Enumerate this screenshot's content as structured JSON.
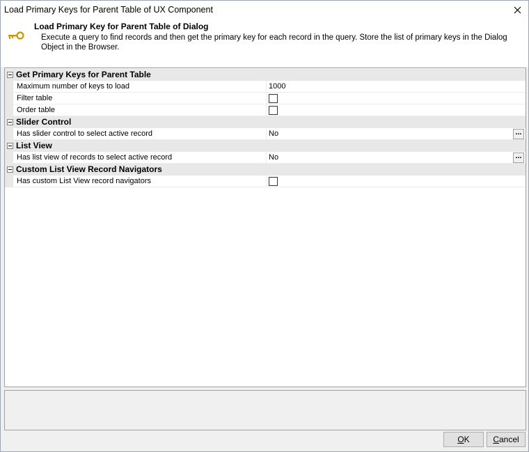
{
  "window": {
    "title": "Load Primary Keys for Parent Table of UX Component"
  },
  "header": {
    "title": "Load Primary Key for Parent Table of Dialog",
    "description": "Execute a query to find records and then get the primary key for each record in the query. Store the list of primary keys in the Dialog Object in the Browser."
  },
  "sections": [
    {
      "label": "Get Primary Keys for Parent Table",
      "properties": [
        {
          "name": "Maximum number of keys to load",
          "value": "1000"
        },
        {
          "name": "Filter table",
          "checked": false
        },
        {
          "name": "Order table",
          "checked": false
        }
      ]
    },
    {
      "label": "Slider Control",
      "properties": [
        {
          "name": "Has slider control to select active record",
          "value": "No",
          "button": "..."
        }
      ]
    },
    {
      "label": "List View",
      "properties": [
        {
          "name": "Has list view of records to select active record",
          "value": "No",
          "button": "..."
        }
      ]
    },
    {
      "label": "Custom List View Record Navigators",
      "properties": [
        {
          "name": "Has custom List View record navigators",
          "checked": false
        }
      ]
    }
  ],
  "buttons": {
    "ok_accel": "O",
    "ok_rest": "K",
    "cancel_accel": "C",
    "cancel_rest": "ancel"
  },
  "icons": {
    "header": "key-icon",
    "close": "close-icon"
  }
}
